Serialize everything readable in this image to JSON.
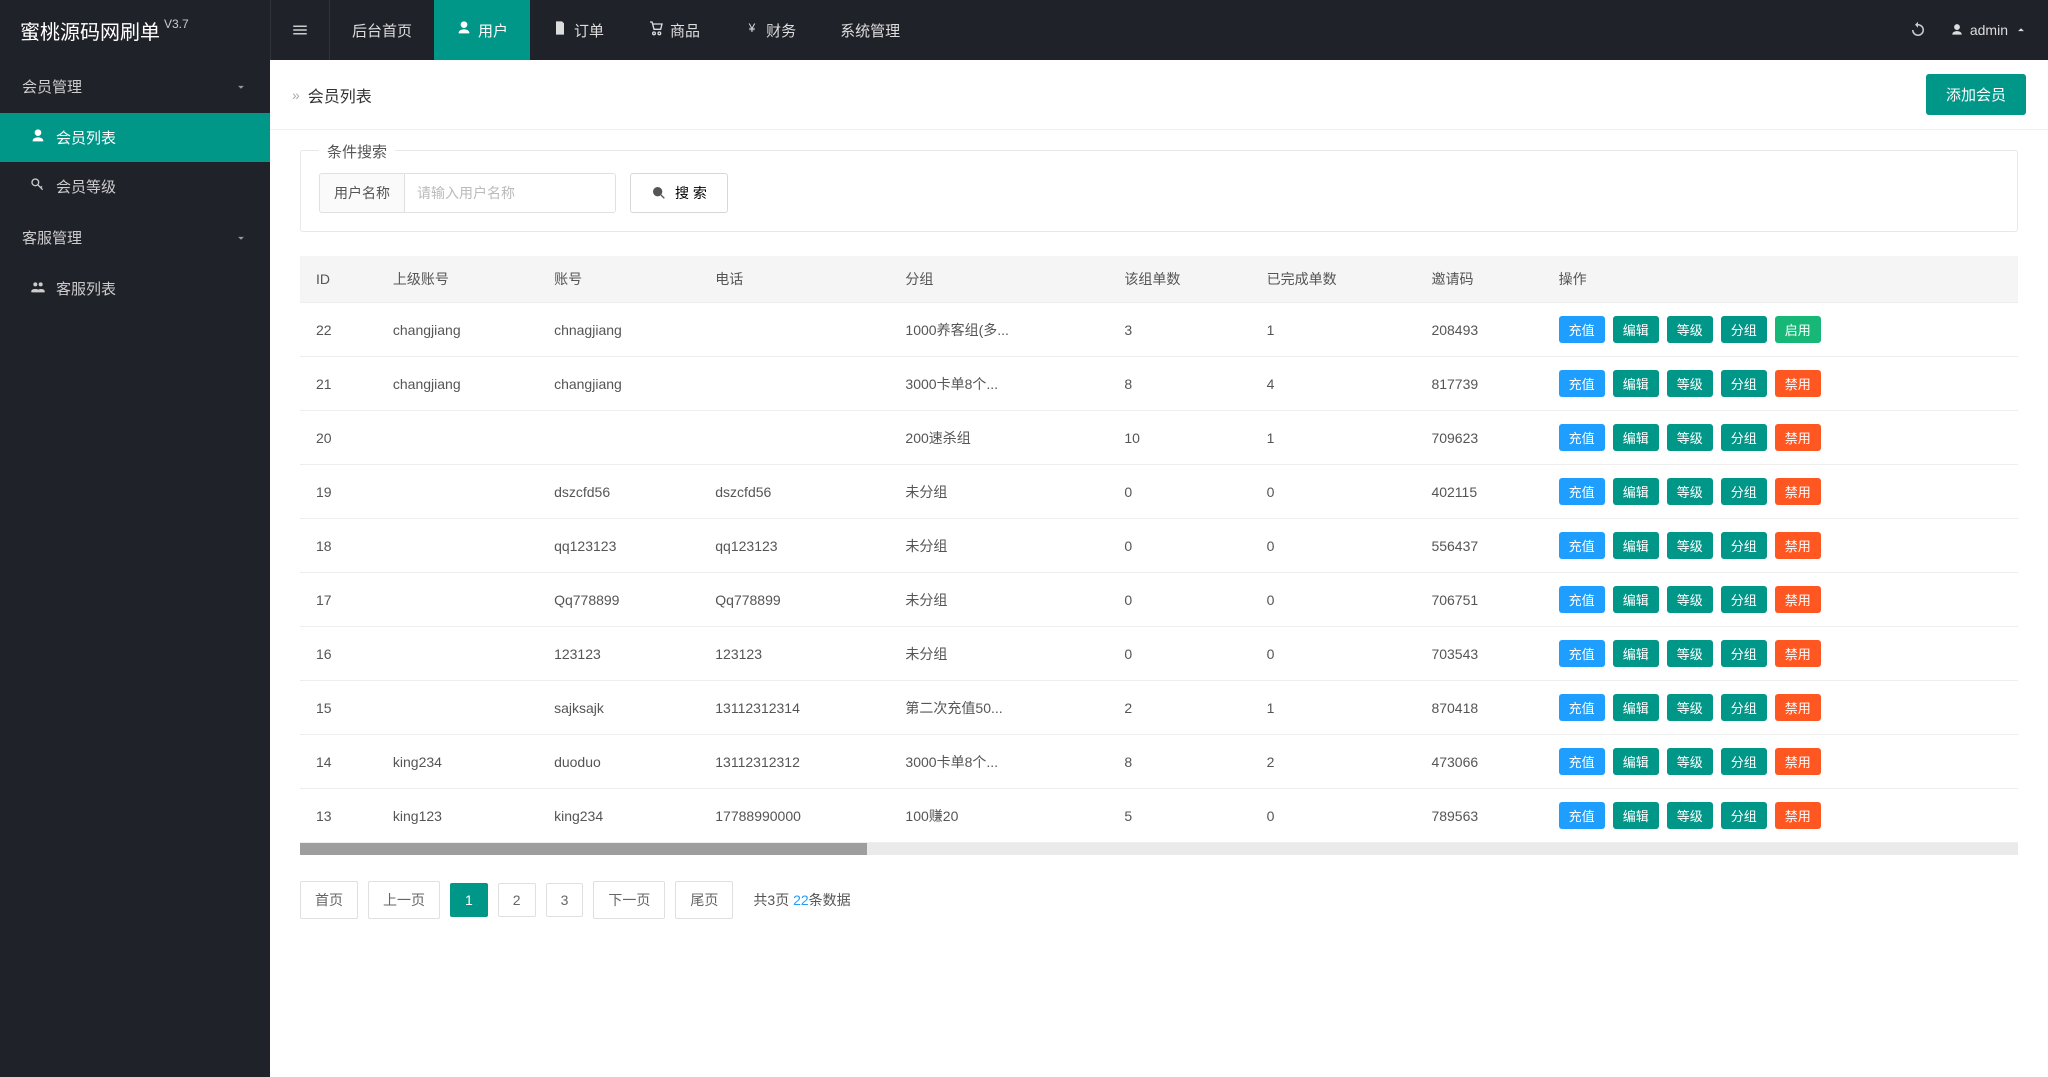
{
  "brand": {
    "name": "蜜桃源码网刷单",
    "version": "V3.7"
  },
  "topnav": [
    {
      "label": "后台首页",
      "icon": ""
    },
    {
      "label": "用户",
      "icon": "user",
      "active": true
    },
    {
      "label": "订单",
      "icon": "doc"
    },
    {
      "label": "商品",
      "icon": "cart"
    },
    {
      "label": "财务",
      "icon": "yen"
    },
    {
      "label": "系统管理",
      "icon": ""
    }
  ],
  "currentUser": "admin",
  "sidebar": {
    "groups": [
      {
        "title": "会员管理",
        "items": [
          {
            "label": "会员列表",
            "icon": "user",
            "active": true
          },
          {
            "label": "会员等级",
            "icon": "key"
          }
        ]
      },
      {
        "title": "客服管理",
        "items": [
          {
            "label": "客服列表",
            "icon": "people"
          }
        ]
      }
    ]
  },
  "breadcrumb": {
    "title": "会员列表",
    "addBtn": "添加会员"
  },
  "search": {
    "legend": "条件搜索",
    "addon": "用户名称",
    "placeholder": "请输入用户名称",
    "btn": "搜 索"
  },
  "table": {
    "cols": [
      "ID",
      "上级账号",
      "账号",
      "电话",
      "分组",
      "该组单数",
      "已完成单数",
      "邀请码",
      "操作"
    ],
    "actions": {
      "recharge": "充值",
      "edit": "编辑",
      "level": "等级",
      "group": "分组",
      "enable": "启用",
      "disable": "禁用"
    },
    "rows": [
      {
        "id": "22",
        "parent": "changjiang",
        "account": "chnagjiang",
        "phone": "",
        "group": "1000养客组(多...",
        "groupCount": "3",
        "done": "1",
        "invite": "208493",
        "status": "enable"
      },
      {
        "id": "21",
        "parent": "changjiang",
        "account": "changjiang",
        "phone": "",
        "group": "3000卡单8个...",
        "groupCount": "8",
        "done": "4",
        "invite": "817739",
        "status": "disable"
      },
      {
        "id": "20",
        "parent": "",
        "account": "",
        "phone": "",
        "group": "200速杀组",
        "groupCount": "10",
        "done": "1",
        "invite": "709623",
        "status": "disable"
      },
      {
        "id": "19",
        "parent": "",
        "account": "dszcfd56",
        "phone": "dszcfd56",
        "group": "未分组",
        "groupCount": "0",
        "done": "0",
        "invite": "402115",
        "status": "disable"
      },
      {
        "id": "18",
        "parent": "",
        "account": "qq123123",
        "phone": "qq123123",
        "group": "未分组",
        "groupCount": "0",
        "done": "0",
        "invite": "556437",
        "status": "disable"
      },
      {
        "id": "17",
        "parent": "",
        "account": "Qq778899",
        "phone": "Qq778899",
        "group": "未分组",
        "groupCount": "0",
        "done": "0",
        "invite": "706751",
        "status": "disable"
      },
      {
        "id": "16",
        "parent": "",
        "account": "123123",
        "phone": "123123",
        "group": "未分组",
        "groupCount": "0",
        "done": "0",
        "invite": "703543",
        "status": "disable"
      },
      {
        "id": "15",
        "parent": "",
        "account": "sajksajk",
        "phone": "13112312314",
        "group": "第二次充值50...",
        "groupCount": "2",
        "done": "1",
        "invite": "870418",
        "status": "disable"
      },
      {
        "id": "14",
        "parent": "king234",
        "account": "duoduo",
        "phone": "13112312312",
        "group": "3000卡单8个...",
        "groupCount": "8",
        "done": "2",
        "invite": "473066",
        "status": "disable"
      },
      {
        "id": "13",
        "parent": "king123",
        "account": "king234",
        "phone": "17788990000",
        "group": "100赚20",
        "groupCount": "5",
        "done": "0",
        "invite": "789563",
        "status": "disable"
      }
    ]
  },
  "pager": {
    "first": "首页",
    "prev": "上一页",
    "next": "下一页",
    "last": "尾页",
    "pages": [
      "1",
      "2",
      "3"
    ],
    "current": 0,
    "infoPrefix": "共",
    "infoMid": "页 ",
    "infoSuffix": "条数据",
    "totalPages": "3",
    "totalRecords": "22"
  }
}
